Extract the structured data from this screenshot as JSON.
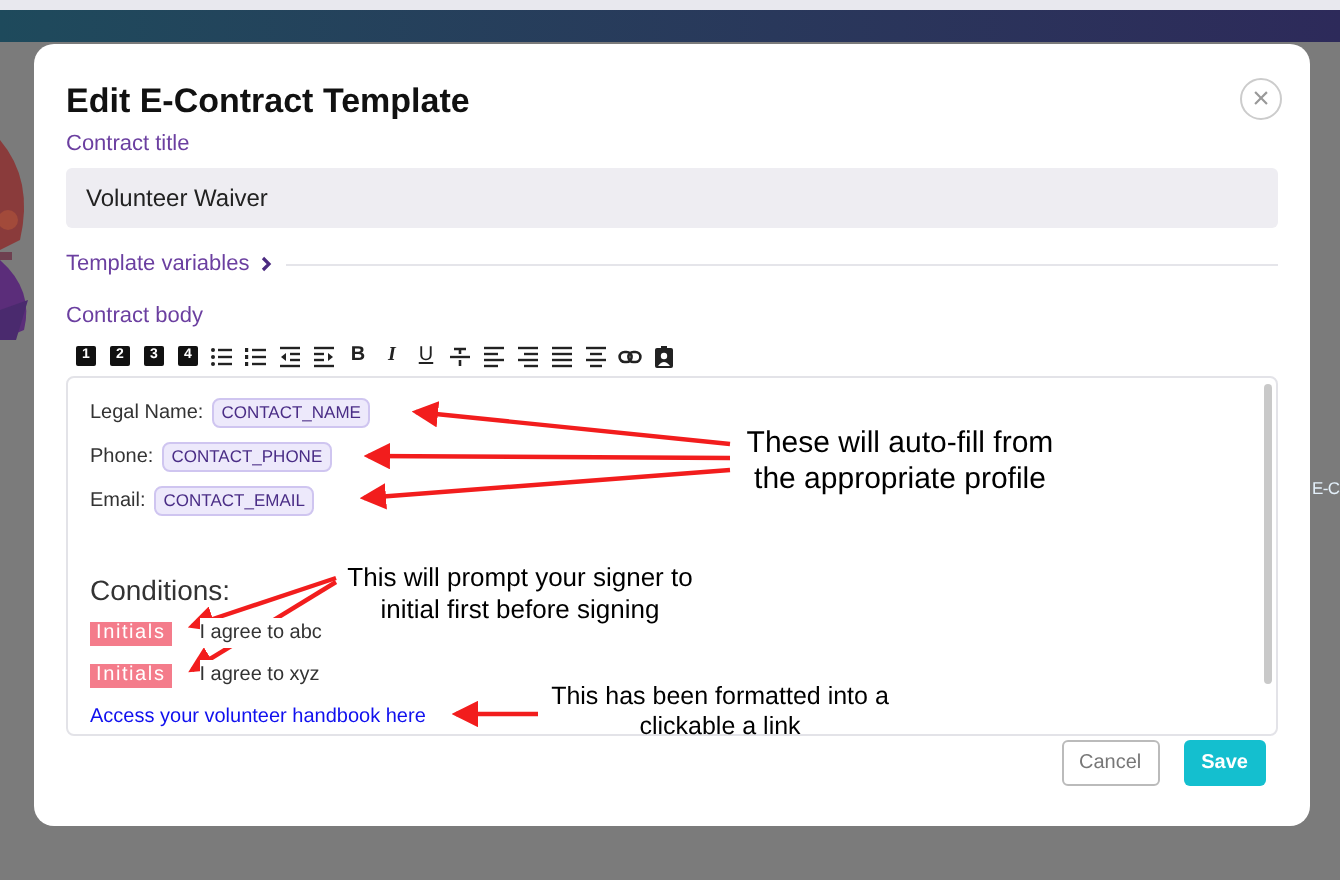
{
  "background_text": "E-C",
  "dialog": {
    "title": "Edit E-Contract Template",
    "close_label": "×",
    "contract_title": {
      "label": "Contract title",
      "value": "Volunteer Waiver"
    },
    "template_variables": {
      "label": "Template variables",
      "expanded": false
    },
    "contract_body": {
      "label": "Contract body",
      "toolbar": [
        {
          "kind": "heading",
          "label": "1"
        },
        {
          "kind": "heading",
          "label": "2"
        },
        {
          "kind": "heading",
          "label": "3"
        },
        {
          "kind": "heading",
          "label": "4"
        },
        {
          "kind": "bullets"
        },
        {
          "kind": "numbers"
        },
        {
          "kind": "outdent"
        },
        {
          "kind": "indent"
        },
        {
          "kind": "bold",
          "label": "B"
        },
        {
          "kind": "italic",
          "label": "I"
        },
        {
          "kind": "underline",
          "label": "U"
        },
        {
          "kind": "strike"
        },
        {
          "kind": "align-left"
        },
        {
          "kind": "align-right"
        },
        {
          "kind": "justify"
        },
        {
          "kind": "center"
        },
        {
          "kind": "link"
        },
        {
          "kind": "contact"
        }
      ],
      "lines": [
        {
          "kind": "field",
          "label": "Legal Name:",
          "variable": "CONTACT_NAME"
        },
        {
          "kind": "field",
          "label": "Phone:",
          "variable": "CONTACT_PHONE"
        },
        {
          "kind": "field",
          "label": "Email:",
          "variable": "CONTACT_EMAIL"
        },
        {
          "kind": "heading",
          "text": "Conditions:"
        },
        {
          "kind": "initials",
          "tag": "Initials",
          "text": "I agree to abc"
        },
        {
          "kind": "initials",
          "tag": "Initials",
          "text": "I agree to xyz"
        },
        {
          "kind": "link",
          "text": "Access your volunteer handbook here"
        }
      ]
    },
    "buttons": [
      {
        "kind": "secondary",
        "label": "Cancel"
      },
      {
        "kind": "primary",
        "label": "Save"
      }
    ]
  },
  "annotations": [
    {
      "text": "These will auto-fill from the appropriate profile"
    },
    {
      "text": "This will prompt your signer to initial first before signing"
    },
    {
      "text": "This has been formatted into a clickable a link"
    }
  ]
}
